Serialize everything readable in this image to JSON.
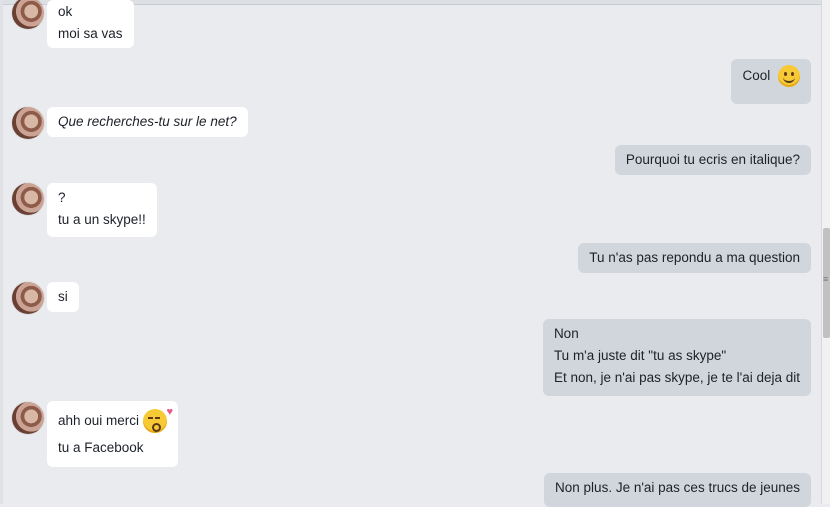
{
  "messages": [
    {
      "side": "in",
      "lines": [
        "ok",
        "moi sa vas"
      ]
    },
    {
      "side": "out",
      "lines": [
        "Cool"
      ],
      "emoji": "smiling-face-icon"
    },
    {
      "side": "in",
      "lines": [
        "Que recherches-tu sur le net?"
      ],
      "italic": true
    },
    {
      "side": "out",
      "lines": [
        "Pourquoi tu ecris en italique?"
      ]
    },
    {
      "side": "in",
      "lines": [
        "?",
        "tu a un skype!!"
      ]
    },
    {
      "side": "out",
      "lines": [
        "Tu n'as pas repondu a ma question"
      ]
    },
    {
      "side": "in",
      "lines": [
        "si"
      ]
    },
    {
      "side": "out",
      "lines": [
        "Non",
        "Tu m'a juste dit \"tu as skype\"",
        "Et non, je n'ai pas skype, je te l'ai deja dit"
      ]
    },
    {
      "side": "in",
      "lines": [
        "ahh oui merci",
        "tu a  Facebook"
      ],
      "emoji": "kissing-face-heart-icon"
    },
    {
      "side": "out",
      "lines": [
        "Non plus. Je n'ai pas ces trucs de jeunes"
      ]
    }
  ],
  "colors": {
    "incoming_bubble": "#ffffff",
    "outgoing_bubble": "#d1d6dc",
    "background": "#e9ebee"
  }
}
